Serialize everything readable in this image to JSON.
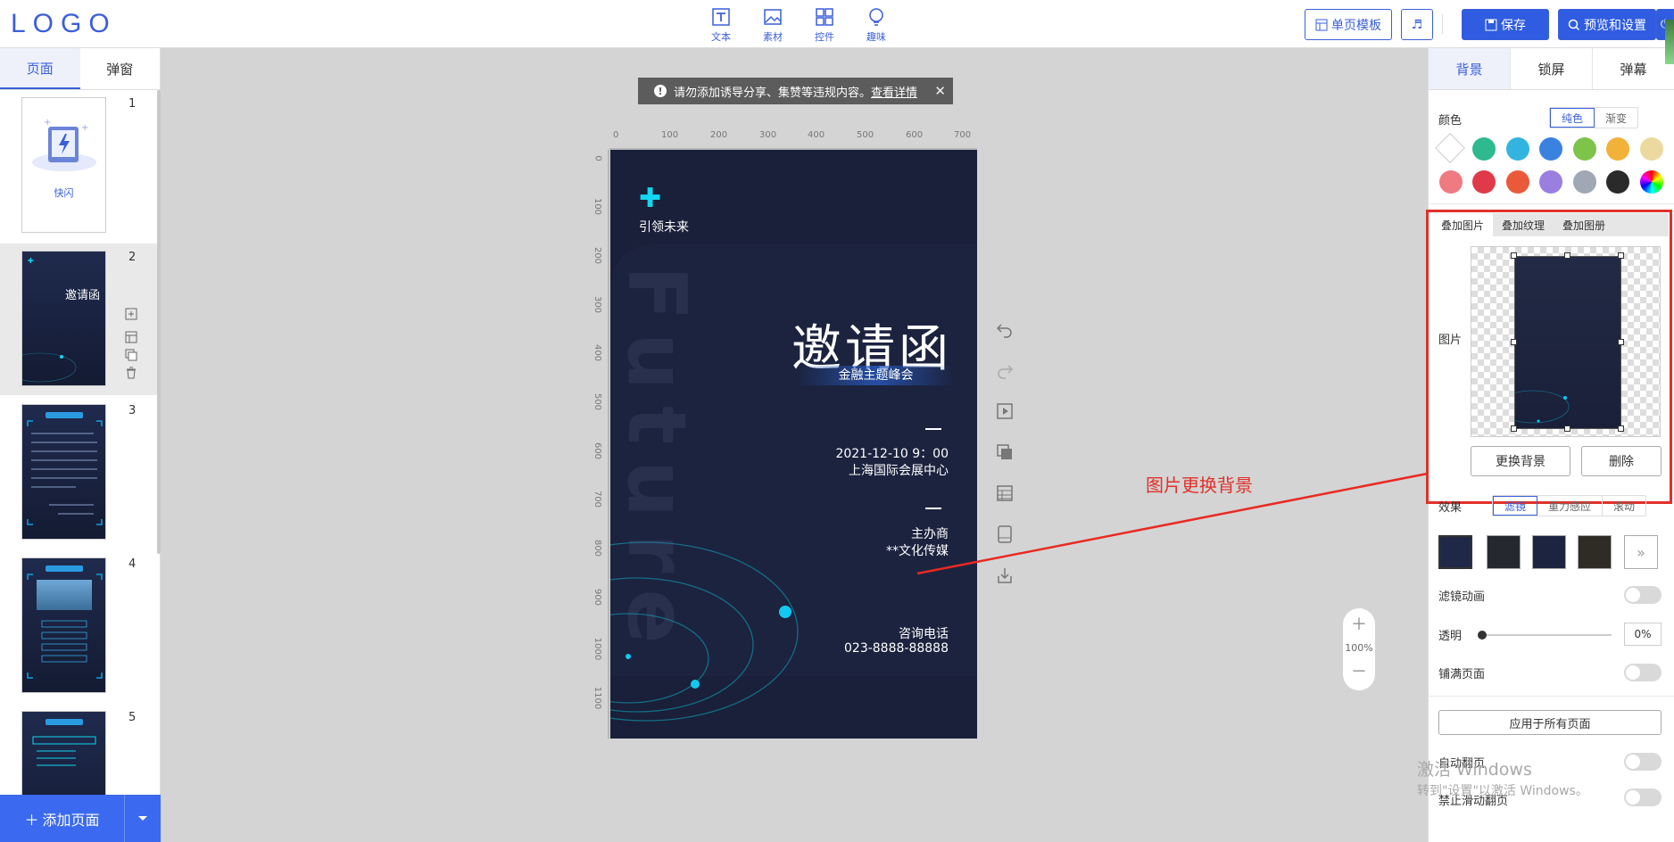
{
  "header": {
    "logo": "LOGO",
    "tools": [
      {
        "label": "文本",
        "icon": "text-icon"
      },
      {
        "label": "素材",
        "icon": "image-icon"
      },
      {
        "label": "控件",
        "icon": "widget-icon"
      },
      {
        "label": "趣味",
        "icon": "bulb-icon"
      }
    ],
    "single_template": "单页模板",
    "save": "保存",
    "preview_settings": "预览和设置"
  },
  "left_panel": {
    "tabs": [
      "页面",
      "弹窗"
    ],
    "pages": [
      {
        "number": "1",
        "thumb_label": "快闪"
      },
      {
        "number": "2",
        "thumb_title": "邀请函"
      },
      {
        "number": "3"
      },
      {
        "number": "4"
      },
      {
        "number": "5"
      }
    ],
    "add_page": "添加页面"
  },
  "notice": {
    "text": "请勿添加诱导分享、集赞等违规内容。",
    "link": "查看详情"
  },
  "ruler": {
    "top": [
      "0",
      "100",
      "200",
      "300",
      "400",
      "500",
      "600",
      "700"
    ],
    "left": [
      "0",
      "100",
      "200",
      "300",
      "400",
      "500",
      "600",
      "700",
      "800",
      "900",
      "1000",
      "1100"
    ]
  },
  "canvas": {
    "tagline": "引领未来",
    "watermark": "Future",
    "title": "邀请函",
    "subtitle": "金融主题峰会",
    "datetime": "2021-12-10 9：00",
    "venue": "上海国际会展中心",
    "organizer_label": "主办商",
    "organizer": "**文化传媒",
    "contact_label": "咨询电话",
    "contact": "023-8888-88888"
  },
  "annotation": "图片更换背景",
  "zoom": "100%",
  "right_panel": {
    "tabs": [
      "背景",
      "锁屏",
      "弹幕"
    ],
    "color_label": "颜色",
    "color_modes": [
      "纯色",
      "渐变"
    ],
    "swatches_row1": [
      "#ffffff",
      "#2fb98f",
      "#33b4e0",
      "#3b82e0",
      "#7ec34a",
      "#f2b23a",
      "#ecd9a0"
    ],
    "swatches_row2": [
      "#f07a82",
      "#e03a4a",
      "#ea5a3a",
      "#9a7fe0",
      "#a0a8b6",
      "#2a2a2a",
      "rainbow"
    ],
    "overlay_tabs": [
      "叠加图片",
      "叠加纹理",
      "叠加图册"
    ],
    "image_label": "图片",
    "replace_bg": "更换背景",
    "delete": "删除",
    "effect_label": "效果",
    "effect_tabs": [
      "滤镜",
      "重力感应",
      "滚动"
    ],
    "filter_anim": "滤镜动画",
    "opacity_label": "透明",
    "opacity_value": "0%",
    "fill_page": "铺满页面",
    "apply_all": "应用于所有页面",
    "auto_flip": "自动翻页",
    "disable_swipe": "禁止滑动翻页"
  },
  "system_watermark": {
    "line1": "激活 Windows",
    "line2": "转到\"设置\"以激活 Windows。"
  }
}
